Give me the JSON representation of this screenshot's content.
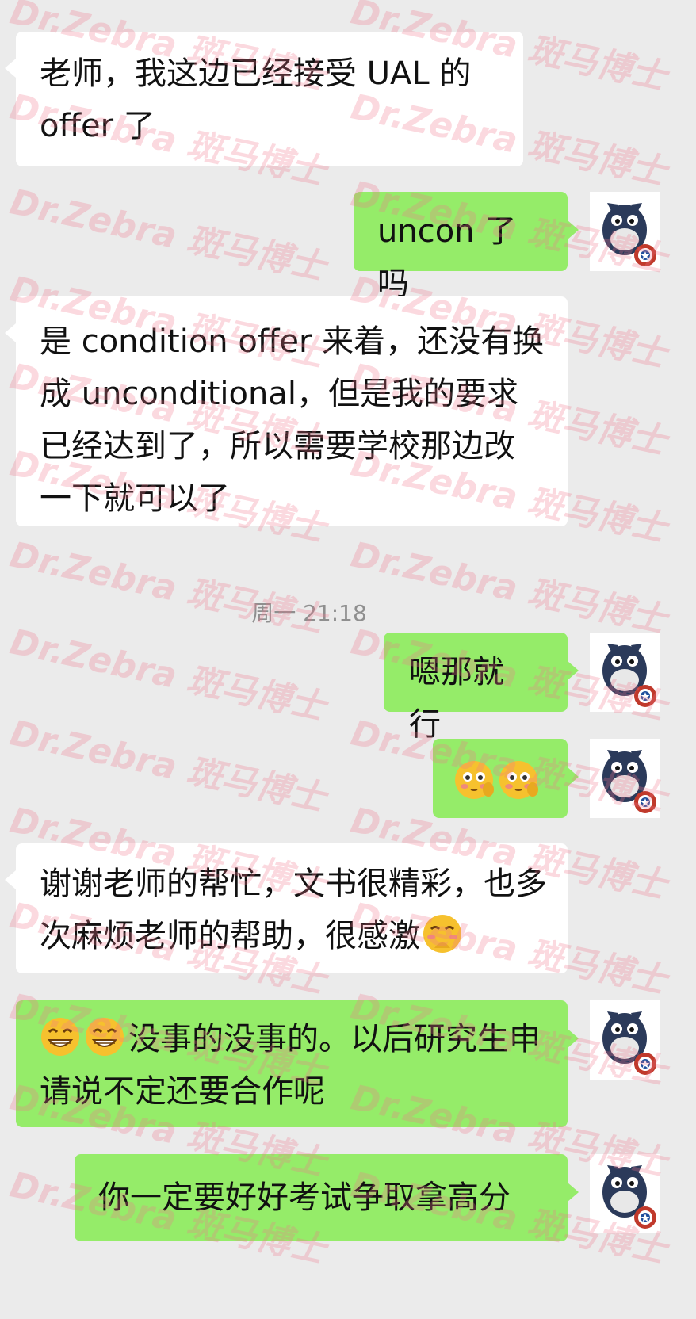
{
  "watermark": "Dr.Zebra 斑马博士",
  "colors": {
    "background": "#ebebeb",
    "incoming_bubble": "#ffffff",
    "outgoing_bubble": "#95ec69",
    "timestamp": "#8f8f8f"
  },
  "messages": [
    {
      "side": "in",
      "text": "老师，我这边已经接受 UAL 的 offer 了"
    },
    {
      "side": "out",
      "text": "uncon 了吗"
    },
    {
      "side": "in",
      "text": "是 condition offer 来着，还没有换成 unconditional，但是我的要求已经达到了，所以需要学校那边改一下就可以了"
    },
    {
      "side": "out",
      "text": "嗯那就行"
    },
    {
      "side": "out",
      "text": "",
      "emoji": [
        "shy-face-icon",
        "shy-face-icon"
      ]
    },
    {
      "side": "in",
      "text": "谢谢老师的帮忙，文书很精彩，也多次麻烦老师的帮助，很感激",
      "emoji_after": "hand-over-mouth-icon"
    },
    {
      "side": "out",
      "text": "没事的没事的。以后研究生申请说不定还要合作呢",
      "emoji_before": [
        "grin-icon",
        "grin-icon"
      ]
    },
    {
      "side": "out",
      "text": "你一定要好好考试争取拿高分"
    }
  ],
  "timestamp": "周一 21:18"
}
